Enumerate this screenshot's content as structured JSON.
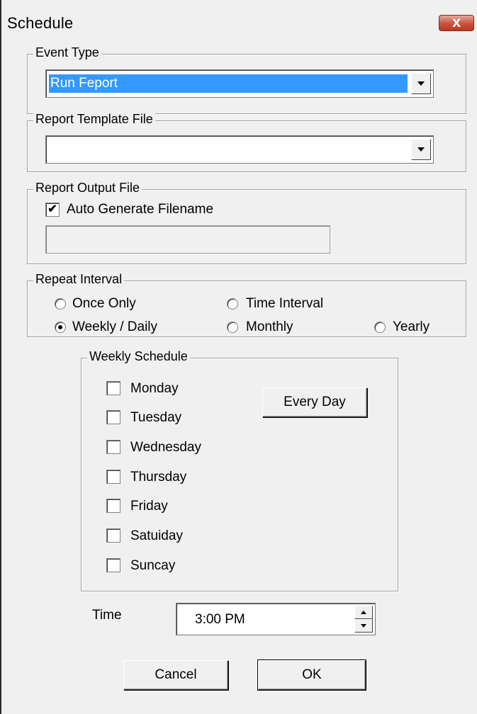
{
  "window": {
    "title": "Schedule",
    "close_glyph": "X"
  },
  "event_type": {
    "group_label": "Event Type",
    "selected_value": "Run Feport"
  },
  "report_template": {
    "group_label": "Report Template File",
    "selected_value": ""
  },
  "report_output": {
    "group_label": "Report Output File",
    "auto_generate_label": "Auto Generate Filename",
    "auto_generate_checked": true,
    "filename_value": ""
  },
  "repeat_interval": {
    "group_label": "Repeat Interval",
    "options": [
      {
        "label": "Once Only",
        "selected": false
      },
      {
        "label": "Time Interval",
        "selected": false
      },
      {
        "label": "Weekly / Daily",
        "selected": true
      },
      {
        "label": "Monthly",
        "selected": false
      },
      {
        "label": "Yearly",
        "selected": false
      }
    ]
  },
  "weekly_schedule": {
    "group_label": "Weekly Schedule",
    "days": [
      {
        "label": "Monday",
        "checked": false
      },
      {
        "label": "Tuesday",
        "checked": false
      },
      {
        "label": "Wednesday",
        "checked": false
      },
      {
        "label": "Thursday",
        "checked": false
      },
      {
        "label": "Friday",
        "checked": false
      },
      {
        "label": "Satuiday",
        "checked": false
      },
      {
        "label": "Suncay",
        "checked": false
      }
    ],
    "every_day_label": "Every Day"
  },
  "time": {
    "label": "Time",
    "value": "3:00 PM"
  },
  "buttons": {
    "cancel_label": "Cancel",
    "ok_label": "OK"
  },
  "check_glyph": "✔"
}
